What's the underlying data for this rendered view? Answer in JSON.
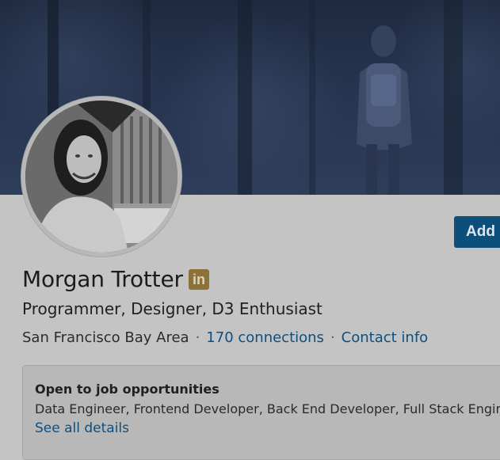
{
  "profile": {
    "name": "Morgan Trotter",
    "badge_icon": "linkedin-icon",
    "badge_text": "in",
    "headline": "Programmer, Designer, D3 Enthusiast",
    "location": "San Francisco Bay Area",
    "separator": "·",
    "connections": "170 connections",
    "contact_info": "Contact info"
  },
  "actions": {
    "add_label": "Add"
  },
  "open_to_work": {
    "title": "Open to job opportunities",
    "roles": "Data Engineer, Frontend Developer, Back End Developer, Full Stack Engineer",
    "details_link": "See all details"
  },
  "colors": {
    "link": "#0d4f80",
    "primary_button": "#0b4f7a",
    "badge": "#8c7236",
    "background": "#c4c4c4"
  }
}
